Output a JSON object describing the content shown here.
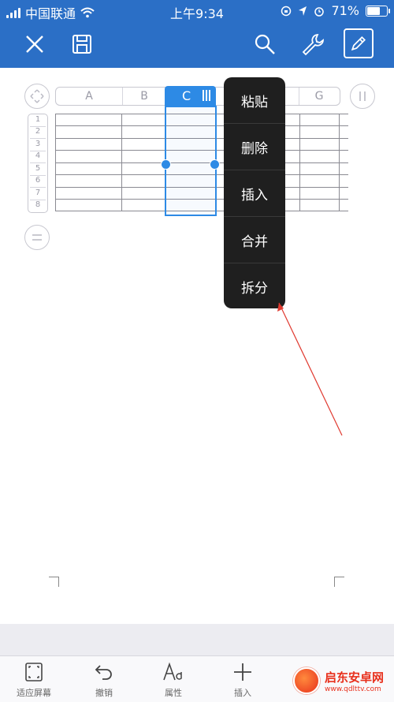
{
  "status_bar": {
    "carrier": "中国联通",
    "time": "上午9:34",
    "battery": "71%",
    "battery_level": 0.71
  },
  "toolbar": {
    "close_icon": "close-icon",
    "save_icon": "save-icon",
    "search_icon": "search-icon",
    "tools_icon": "wrench-icon",
    "edit_icon": "pencil-icon"
  },
  "sheet": {
    "columns": [
      "A",
      "B",
      "C",
      "",
      "",
      "G"
    ],
    "selected_column": "C",
    "rows": [
      "1",
      "2",
      "3",
      "4",
      "5",
      "6",
      "7",
      "8"
    ]
  },
  "context_menu": {
    "items": [
      "粘贴",
      "删除",
      "插入",
      "合并",
      "拆分"
    ]
  },
  "bottom_bar": {
    "items": [
      {
        "label": "适应屏幕",
        "icon": "fit-screen-icon"
      },
      {
        "label": "撤销",
        "icon": "undo-icon"
      },
      {
        "label": "属性",
        "icon": "font-icon"
      },
      {
        "label": "插入",
        "icon": "plus-icon"
      }
    ]
  },
  "watermark": {
    "title": "启东安卓网",
    "url": "www.qdlttv.com"
  },
  "colors": {
    "accent": "#2b6fc6",
    "selection": "#2d8ae5",
    "menu_bg": "#1f1f1f"
  }
}
